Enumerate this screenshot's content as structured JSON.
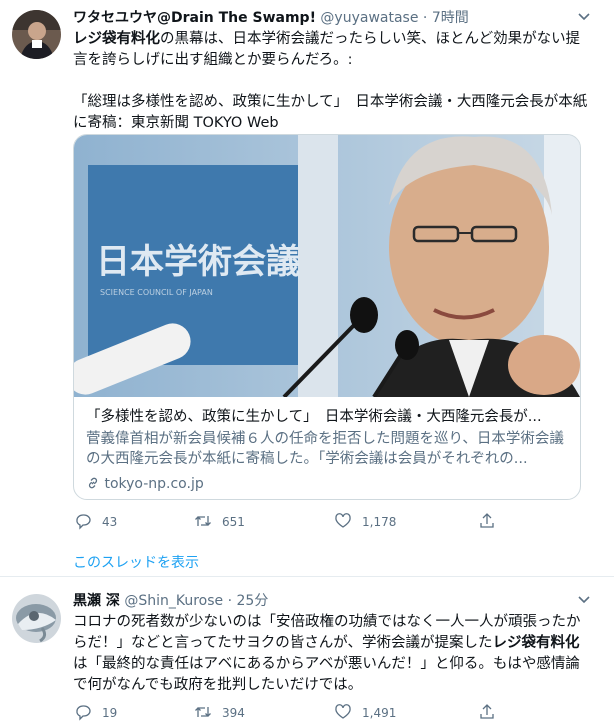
{
  "tweet1": {
    "display_name": "ワタセユウヤ@Drain The Swamp!",
    "handle": "@yuyawatase",
    "separator": "·",
    "time": "7時間",
    "text_bold": "レジ袋有料化",
    "text_rest": "の黒幕は、日本学術会議だったらしい笑、ほとんど効果がない提言を誇らしげに出す組織とか要らんだろ。:\n\n「総理は多様性を認め、政策に生かして」　日本学術会議・大西隆元会長が本紙に寄稿：東京新聞 TOKYO Web",
    "card": {
      "image_sign_text": "日本学術会議",
      "image_sign_sub": "SCIENCE COUNCIL OF JAPAN",
      "title": "「多様性を認め、政策に生かして」　日本学術会議・大西隆元会長が...",
      "description": "菅義偉首相が新会員候補６人の任命を拒否した問題を巡り、日本学術会議の大西隆元会長が本紙に寄稿した。「学術会議は会員がそれぞれの...",
      "domain": "tokyo-np.co.jp"
    },
    "stats": {
      "replies": "43",
      "retweets": "651",
      "likes": "1,178"
    },
    "thread_link": "このスレッドを表示"
  },
  "tweet2": {
    "display_name": "黒瀬 深",
    "handle": "@Shin_Kurose",
    "separator": "·",
    "time": "25分",
    "text_a": "コロナの死者数が少ないのは「安倍政権の功績ではなく一人一人が頑張ったからだ！」などと言ってたサヨクの皆さんが、学術会議が提案した",
    "text_bold": "レジ袋有料化",
    "text_b": "は「最終的な責任はアベにあるからアベが悪いんだ！」と仰る。もはや感情論で何がなんでも政府を批判したいだけでは。",
    "stats": {
      "replies": "19",
      "retweets": "394",
      "likes": "1,491"
    }
  },
  "icons": [
    "avatar",
    "caret-down-icon",
    "reply-icon",
    "retweet-icon",
    "like-icon",
    "share-icon",
    "link-icon"
  ],
  "colors": {
    "link": "#1da1f2",
    "muted": "#5b7083",
    "border": "#cfd9de"
  }
}
